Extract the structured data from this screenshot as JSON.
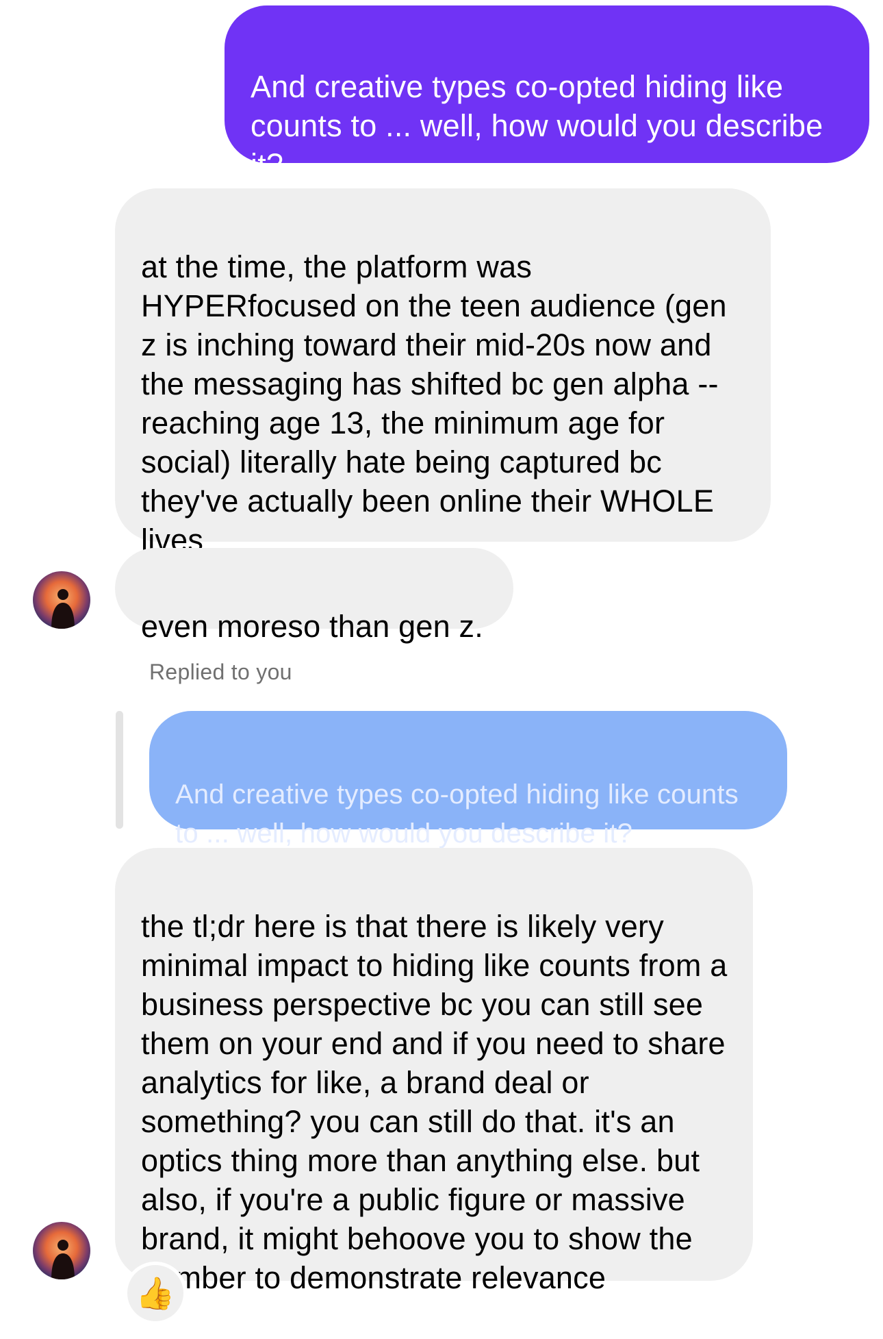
{
  "messages": {
    "sent_1": "And creative types co-opted hiding like counts to ... well, how would you describe it?",
    "received_1": "at the time, the platform was HYPERfocused on the teen audience (gen z is inching toward their mid-20s now and the messaging has shifted bc gen alpha -- reaching age 13, the minimum age for social) literally hate being captured bc they've actually been online their WHOLE lives",
    "received_2": "even moreso than gen z.",
    "reply_label": "Replied to you",
    "quoted_reply": "And creative types co-opted hiding like counts to ... well, how would you describe it?",
    "received_3": "the tl;dr here is that there is likely very minimal impact to hiding like counts from a business perspective bc you can still see them on your end and if you need to share analytics for like, a brand deal or something? you can still do that. it's an optics thing more than anything else. but also, if you're a public figure or massive brand, it might behoove you to show the number to demonstrate relevance"
  },
  "reaction": {
    "emoji": "👍",
    "icon": "thumbs-up-icon"
  },
  "avatar": {
    "icon": "user-avatar-icon"
  },
  "colors": {
    "sent_bubble": "#7033f5",
    "received_bubble": "#efefef",
    "quoted_bubble": "#8ab3f8",
    "reply_label": "#707070"
  }
}
